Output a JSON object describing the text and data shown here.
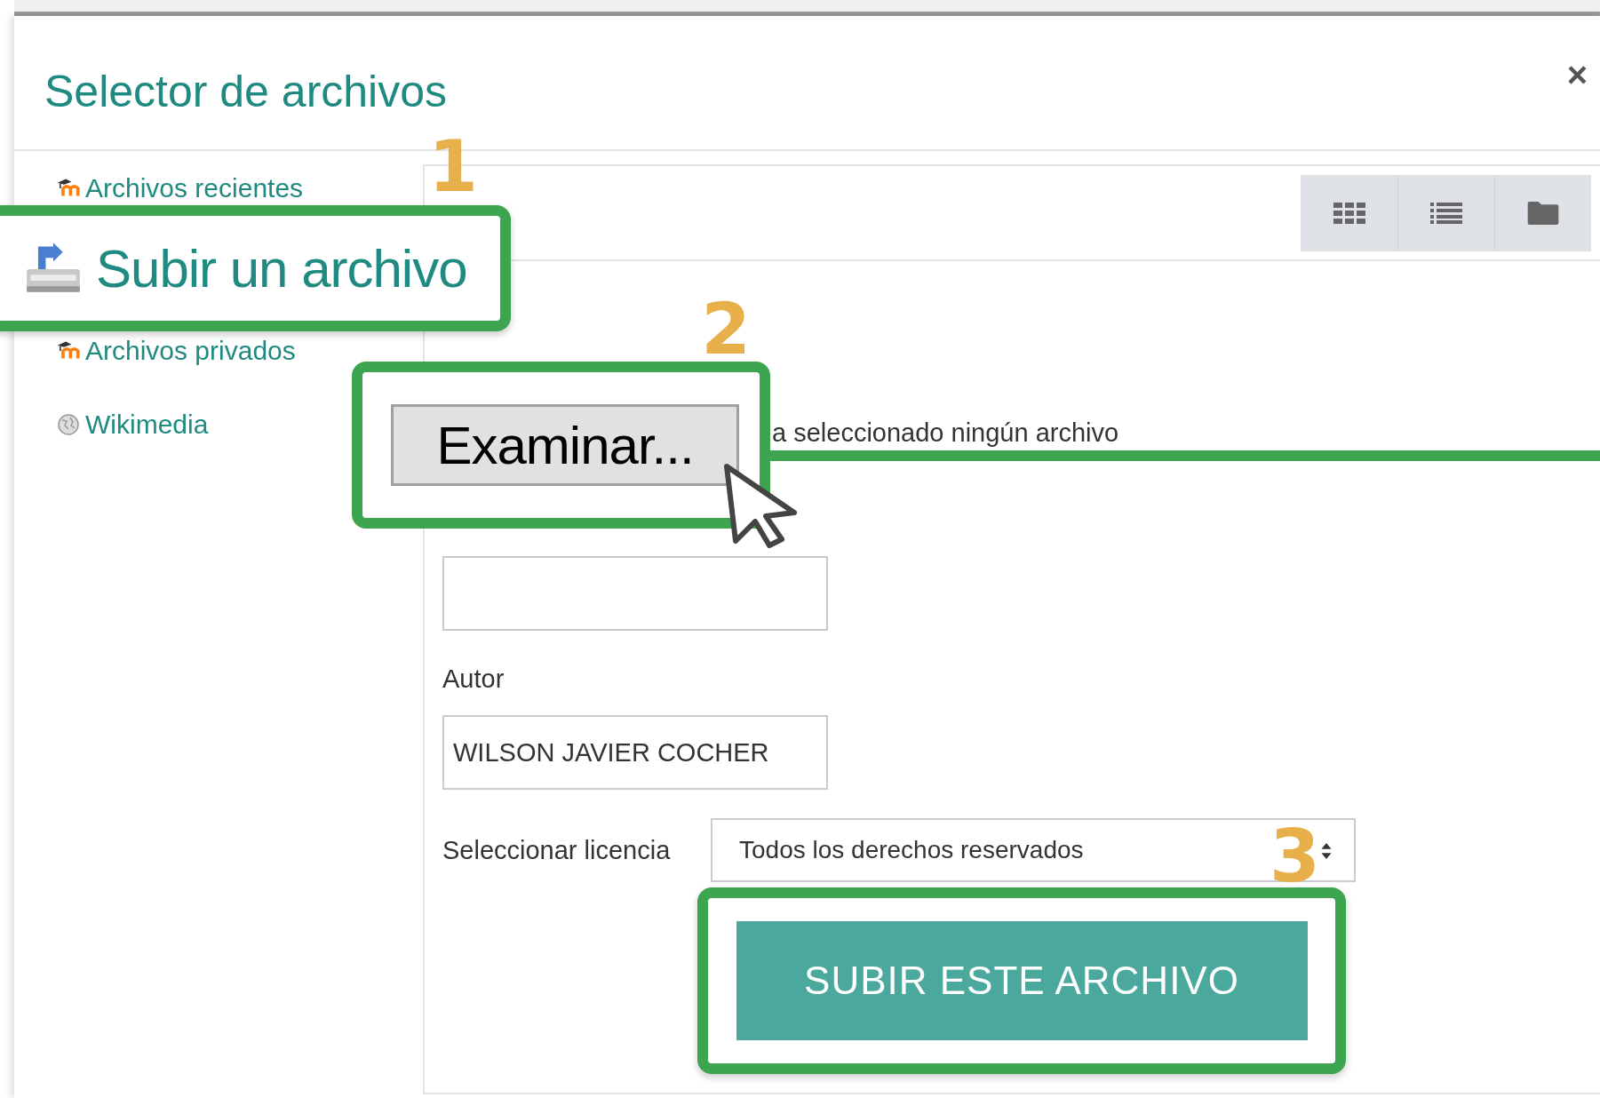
{
  "dialog": {
    "title": "Selector de archivos",
    "close": "×"
  },
  "sidebar": {
    "items": [
      {
        "label": "Archivos recientes",
        "kind": "moodle",
        "highlighted": false
      },
      {
        "label": "Subir un archivo",
        "kind": "upload",
        "highlighted": true,
        "step": "1"
      },
      {
        "label": "Archivos privados",
        "kind": "moodle",
        "highlighted": false
      },
      {
        "label": "Wikimedia",
        "kind": "globe",
        "highlighted": false
      }
    ]
  },
  "toolbar": {
    "views": [
      {
        "kind": "grid"
      },
      {
        "kind": "list"
      },
      {
        "kind": "folder"
      }
    ]
  },
  "upload_form": {
    "browse_button": "Examinar...",
    "browse_step": "2",
    "file_status": "a seleccionado ningún archivo",
    "author_label": "Autor",
    "author_value": "WILSON JAVIER COCHER",
    "license_label": "Seleccionar licencia",
    "license_value": "Todos los derechos reservados",
    "submit_button": "SUBIR ESTE ARCHIVO",
    "submit_step": "3"
  }
}
